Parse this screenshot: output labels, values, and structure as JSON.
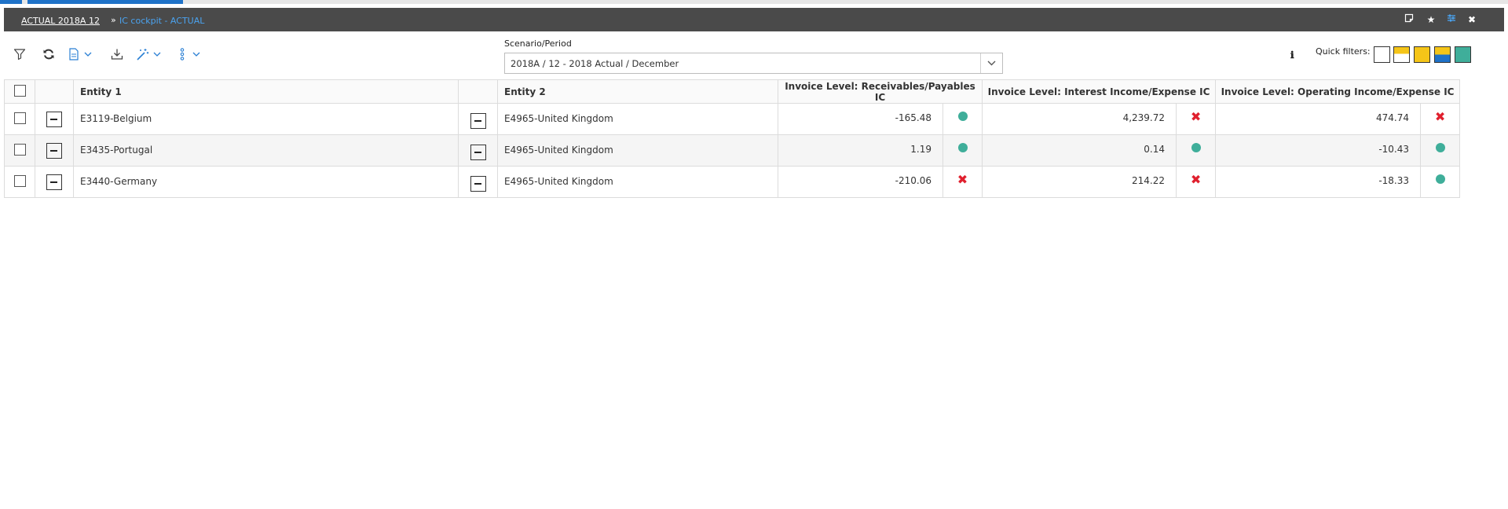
{
  "breadcrumb": {
    "root": "ACTUAL 2018A 12",
    "separator": "»",
    "current": "IC cockpit - ACTUAL"
  },
  "titlebar_icons": [
    "note-icon",
    "star-icon",
    "settings-sliders-icon",
    "close-icon"
  ],
  "titlebar_icon_glyphs": {
    "close": "✖",
    "star": "★"
  },
  "toolbar_icons": [
    "filter-icon",
    "refresh-icon",
    "document-icon",
    "download-icon",
    "magic-wand-icon",
    "more-vertical-icon"
  ],
  "scenario": {
    "label": "Scenario/Period",
    "value": "2018A / 12 - 2018 Actual / December"
  },
  "info_glyph": "ℹ",
  "quick_filters": {
    "label": "Quick filters:",
    "options": [
      "all-white",
      "white-yellow",
      "yellow",
      "yellow-blue",
      "teal"
    ]
  },
  "colors": {
    "accent_blue": "#1f72c8",
    "title_bg": "#4a4a4a",
    "ok_teal": "#3fae9a",
    "err_red": "#e0202e",
    "qf_yellow": "#f5c518",
    "qf_blue": "#1f72c8",
    "qf_teal": "#3fae9a"
  },
  "table": {
    "headers": {
      "entity1": "Entity 1",
      "entity2": "Entity 2",
      "receivables": "Invoice Level: Receivables/Payables IC",
      "interest": "Invoice Level: Interest Income/Expense IC",
      "operating": "Invoice Level: Operating Income/Expense IC"
    },
    "rows": [
      {
        "entity1": "E3119-Belgium",
        "entity2": "E4965-United Kingdom",
        "receivables": "-165.48",
        "receivables_status": "ok",
        "interest": "4,239.72",
        "interest_status": "error",
        "operating": "474.74",
        "operating_status": "error"
      },
      {
        "entity1": "E3435-Portugal",
        "entity2": "E4965-United Kingdom",
        "receivables": "1.19",
        "receivables_status": "ok",
        "interest": "0.14",
        "interest_status": "ok",
        "operating": "-10.43",
        "operating_status": "ok"
      },
      {
        "entity1": "E3440-Germany",
        "entity2": "E4965-United Kingdom",
        "receivables": "-210.06",
        "receivables_status": "error",
        "interest": "214.22",
        "interest_status": "error",
        "operating": "-18.33",
        "operating_status": "ok"
      }
    ]
  }
}
